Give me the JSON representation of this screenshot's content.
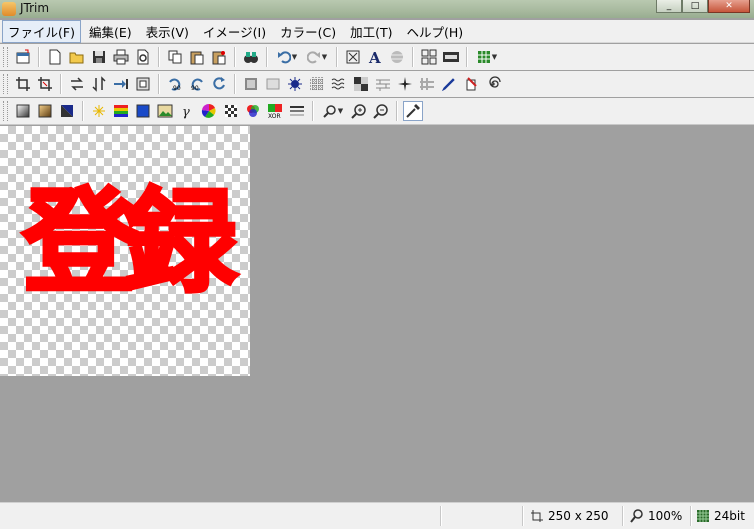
{
  "window": {
    "title": "JTrim"
  },
  "menu": [
    {
      "label": "ファイル(F)"
    },
    {
      "label": "編集(E)"
    },
    {
      "label": "表示(V)"
    },
    {
      "label": "イメージ(I)"
    },
    {
      "label": "カラー(C)"
    },
    {
      "label": "加工(T)"
    },
    {
      "label": "ヘルプ(H)"
    }
  ],
  "toolbar_icons": {
    "row1": [
      "new-window-icon",
      "new-file-icon",
      "open-folder-icon",
      "save-icon",
      "print-icon",
      "print-preview-icon",
      "copy-icon",
      "paste-icon",
      "paste-new-icon",
      "binoculars-icon",
      "undo-icon",
      "redo-icon",
      "fit-window-icon",
      "text-icon",
      "blur-icon",
      "tile-icon",
      "filmstrip-icon",
      "grid-icon"
    ],
    "row2": [
      "crop-icon",
      "trim-icon",
      "flip-horizontal-icon",
      "flip-vertical-icon",
      "shift-icon",
      "frame-icon",
      "rotate-left-90-icon",
      "rotate-right-90-icon",
      "rotate-free-icon",
      "emboss-icon",
      "relief-icon",
      "sunburst-icon",
      "mosaic-icon",
      "wave-icon",
      "checker-icon",
      "brick-icon",
      "spark-icon",
      "ghost-icon",
      "pen-icon",
      "eraser-icon",
      "spiral-icon"
    ],
    "row3": [
      "gradient-gray-icon",
      "gradient-brown-icon",
      "gradient-blue-icon",
      "sparkle-icon",
      "rainbow-icon",
      "color-square-icon",
      "image-icon",
      "gamma-icon",
      "color-wheel-icon",
      "pattern-icon",
      "rgb-circles-icon",
      "xor-icon",
      "halftone-icon",
      "zoom-icon",
      "zoom-in-icon",
      "zoom-out-icon",
      "eyedropper-icon"
    ]
  },
  "image": {
    "text": "登録",
    "text_color": "#ff0000"
  },
  "status": {
    "size": "250 x 250",
    "zoom": "100%",
    "bits": "24bit"
  },
  "colors": {
    "workspace": "#a0a0a0",
    "chrome": "#f0f0f0"
  }
}
